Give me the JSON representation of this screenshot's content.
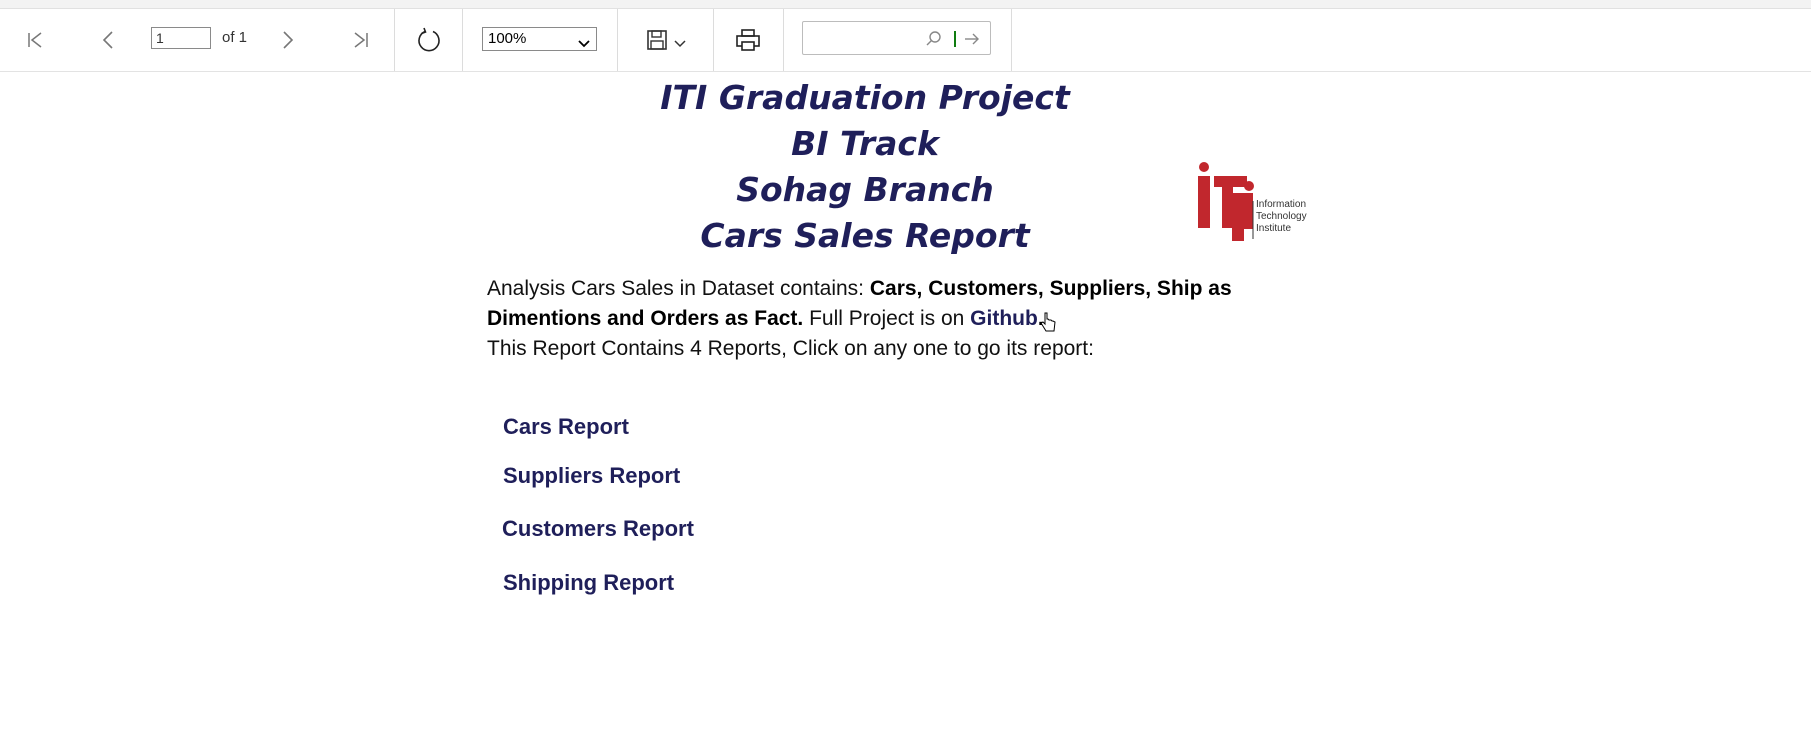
{
  "toolbar": {
    "page_input_value": "1",
    "page_of_label": "of 1",
    "zoom_value": "100%",
    "find_placeholder": "",
    "icons": [
      "first-page-icon",
      "previous-page-icon",
      "next-page-icon",
      "last-page-icon",
      "refresh-icon",
      "save-icon",
      "chevron-down-icon",
      "print-icon",
      "search-icon",
      "find-next-icon"
    ]
  },
  "report": {
    "title_lines": [
      "ITI Graduation Project",
      "BI Track",
      "Sohag Branch",
      "Cars Sales Report"
    ],
    "intro_prefix": "Analysis Cars Sales in Dataset contains: ",
    "intro_bold_1": "Cars, Customers, Suppliers, Ship as",
    "intro_bold_2": "Dimentions and  Orders as Fact.",
    "intro_mid": " Full Project is on ",
    "github_label": "Github",
    "github_suffix": ".",
    "second_line": "This Report Contains 4 Reports, Click on any one to go its report:",
    "links": [
      "Cars Report",
      "Suppliers Report",
      "Customers Report",
      "Shipping Report"
    ]
  },
  "logo": {
    "lines": [
      "Information",
      "Technology",
      "Institute"
    ],
    "brand_color": "#c1272d"
  },
  "colors": {
    "title": "#1f1f5a",
    "link": "#1f1f5a"
  }
}
